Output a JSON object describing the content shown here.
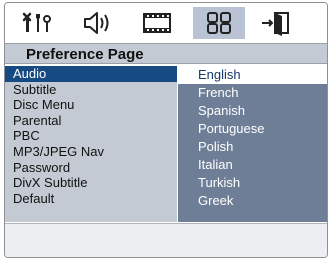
{
  "toolbar": {
    "tabs": [
      {
        "icon": "general-setup-icon",
        "active": false
      },
      {
        "icon": "audio-speaker-icon",
        "active": false
      },
      {
        "icon": "video-film-icon",
        "active": false
      },
      {
        "icon": "preference-grid-icon",
        "active": true
      },
      {
        "icon": "exit-door-icon",
        "active": false
      }
    ]
  },
  "page": {
    "title": "Preference Page"
  },
  "menu": {
    "items": [
      "Audio",
      "Subtitle",
      "Disc Menu",
      "Parental",
      "PBC",
      "MP3/JPEG Nav",
      "Password",
      "DivX Subtitle",
      "Default"
    ],
    "selected_index": 0
  },
  "options": {
    "items": [
      "English",
      "French",
      "Spanish",
      "Portuguese",
      "Polish",
      "Italian",
      "Turkish",
      "Greek"
    ],
    "selected_index": 0
  },
  "colors": {
    "highlight": "#164a82",
    "options_panel": "#6f7e97",
    "menu_panel": "#c4cad3",
    "active_tab": "#b9c3d4"
  }
}
